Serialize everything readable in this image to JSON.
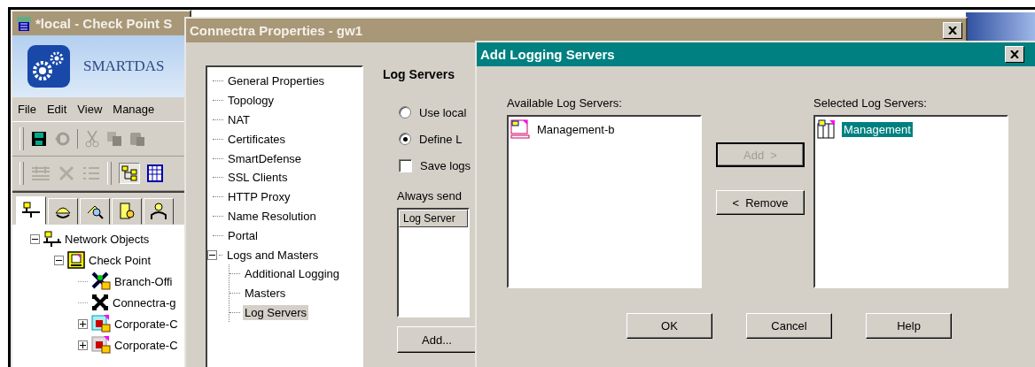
{
  "main_window": {
    "title": "*local - Check Point S",
    "product": "SMARTDAS",
    "menu": [
      "File",
      "Edit",
      "View",
      "Manage"
    ],
    "tabs": [
      {
        "kind": "network",
        "selected": true
      },
      {
        "kind": "services",
        "selected": false
      },
      {
        "kind": "resources",
        "selected": false
      },
      {
        "kind": "servers",
        "selected": false
      },
      {
        "kind": "users",
        "selected": false
      }
    ],
    "tree": [
      {
        "label": "Network Objects",
        "kind": "network",
        "expanded": true,
        "children": [
          {
            "label": "Check Point",
            "kind": "checkpoint",
            "expanded": true,
            "children": [
              {
                "label": "Branch-Offi",
                "kind": "gateway"
              },
              {
                "label": "Connectra-g",
                "kind": "connectra"
              },
              {
                "label": "Corporate-C",
                "kind": "cluster",
                "expanded": false
              },
              {
                "label": "Corporate-C",
                "kind": "cluster-gray",
                "expanded": false
              }
            ]
          }
        ]
      }
    ]
  },
  "connectra_properties": {
    "title": "Connectra Properties - gw1",
    "tree": [
      {
        "label": "General Properties",
        "selected": false
      },
      {
        "label": "Topology",
        "selected": false
      },
      {
        "label": "NAT",
        "selected": false
      },
      {
        "label": "Certificates",
        "selected": false
      },
      {
        "label": "SmartDefense",
        "selected": false
      },
      {
        "label": "SSL Clients",
        "selected": false
      },
      {
        "label": "HTTP Proxy",
        "selected": false
      },
      {
        "label": "Name Resolution",
        "selected": false
      },
      {
        "label": "Portal",
        "selected": false
      },
      {
        "label": "Logs and Masters",
        "selected": false,
        "expanded": true,
        "children": [
          {
            "label": "Additional Logging",
            "selected": false
          },
          {
            "label": "Masters",
            "selected": false
          },
          {
            "label": "Log Servers",
            "selected": true
          }
        ]
      }
    ],
    "heading": "Log Servers",
    "options": [
      {
        "label": "Use local",
        "selected": false
      },
      {
        "label": "Define L",
        "selected": true
      }
    ],
    "save_logs": {
      "label": "Save logs",
      "checked": false
    },
    "always_send_label": "Always send",
    "table": {
      "columns": [
        "Log Server"
      ]
    },
    "add_button": "Add..."
  },
  "add_logging_servers": {
    "title": "Add Logging Servers",
    "available_label": "Available Log Servers:",
    "available": [
      {
        "label": "Management-b",
        "kind": "server",
        "selected": false
      }
    ],
    "selected_label": "Selected Log Servers:",
    "selected_servers": [
      {
        "label": "Management",
        "kind": "module",
        "selected": true
      }
    ],
    "move_buttons": [
      {
        "label": "Add  >",
        "disabled": true
      },
      {
        "label": "<  Remove",
        "disabled": false
      }
    ],
    "buttons": [
      "OK",
      "Cancel",
      "Help"
    ]
  }
}
